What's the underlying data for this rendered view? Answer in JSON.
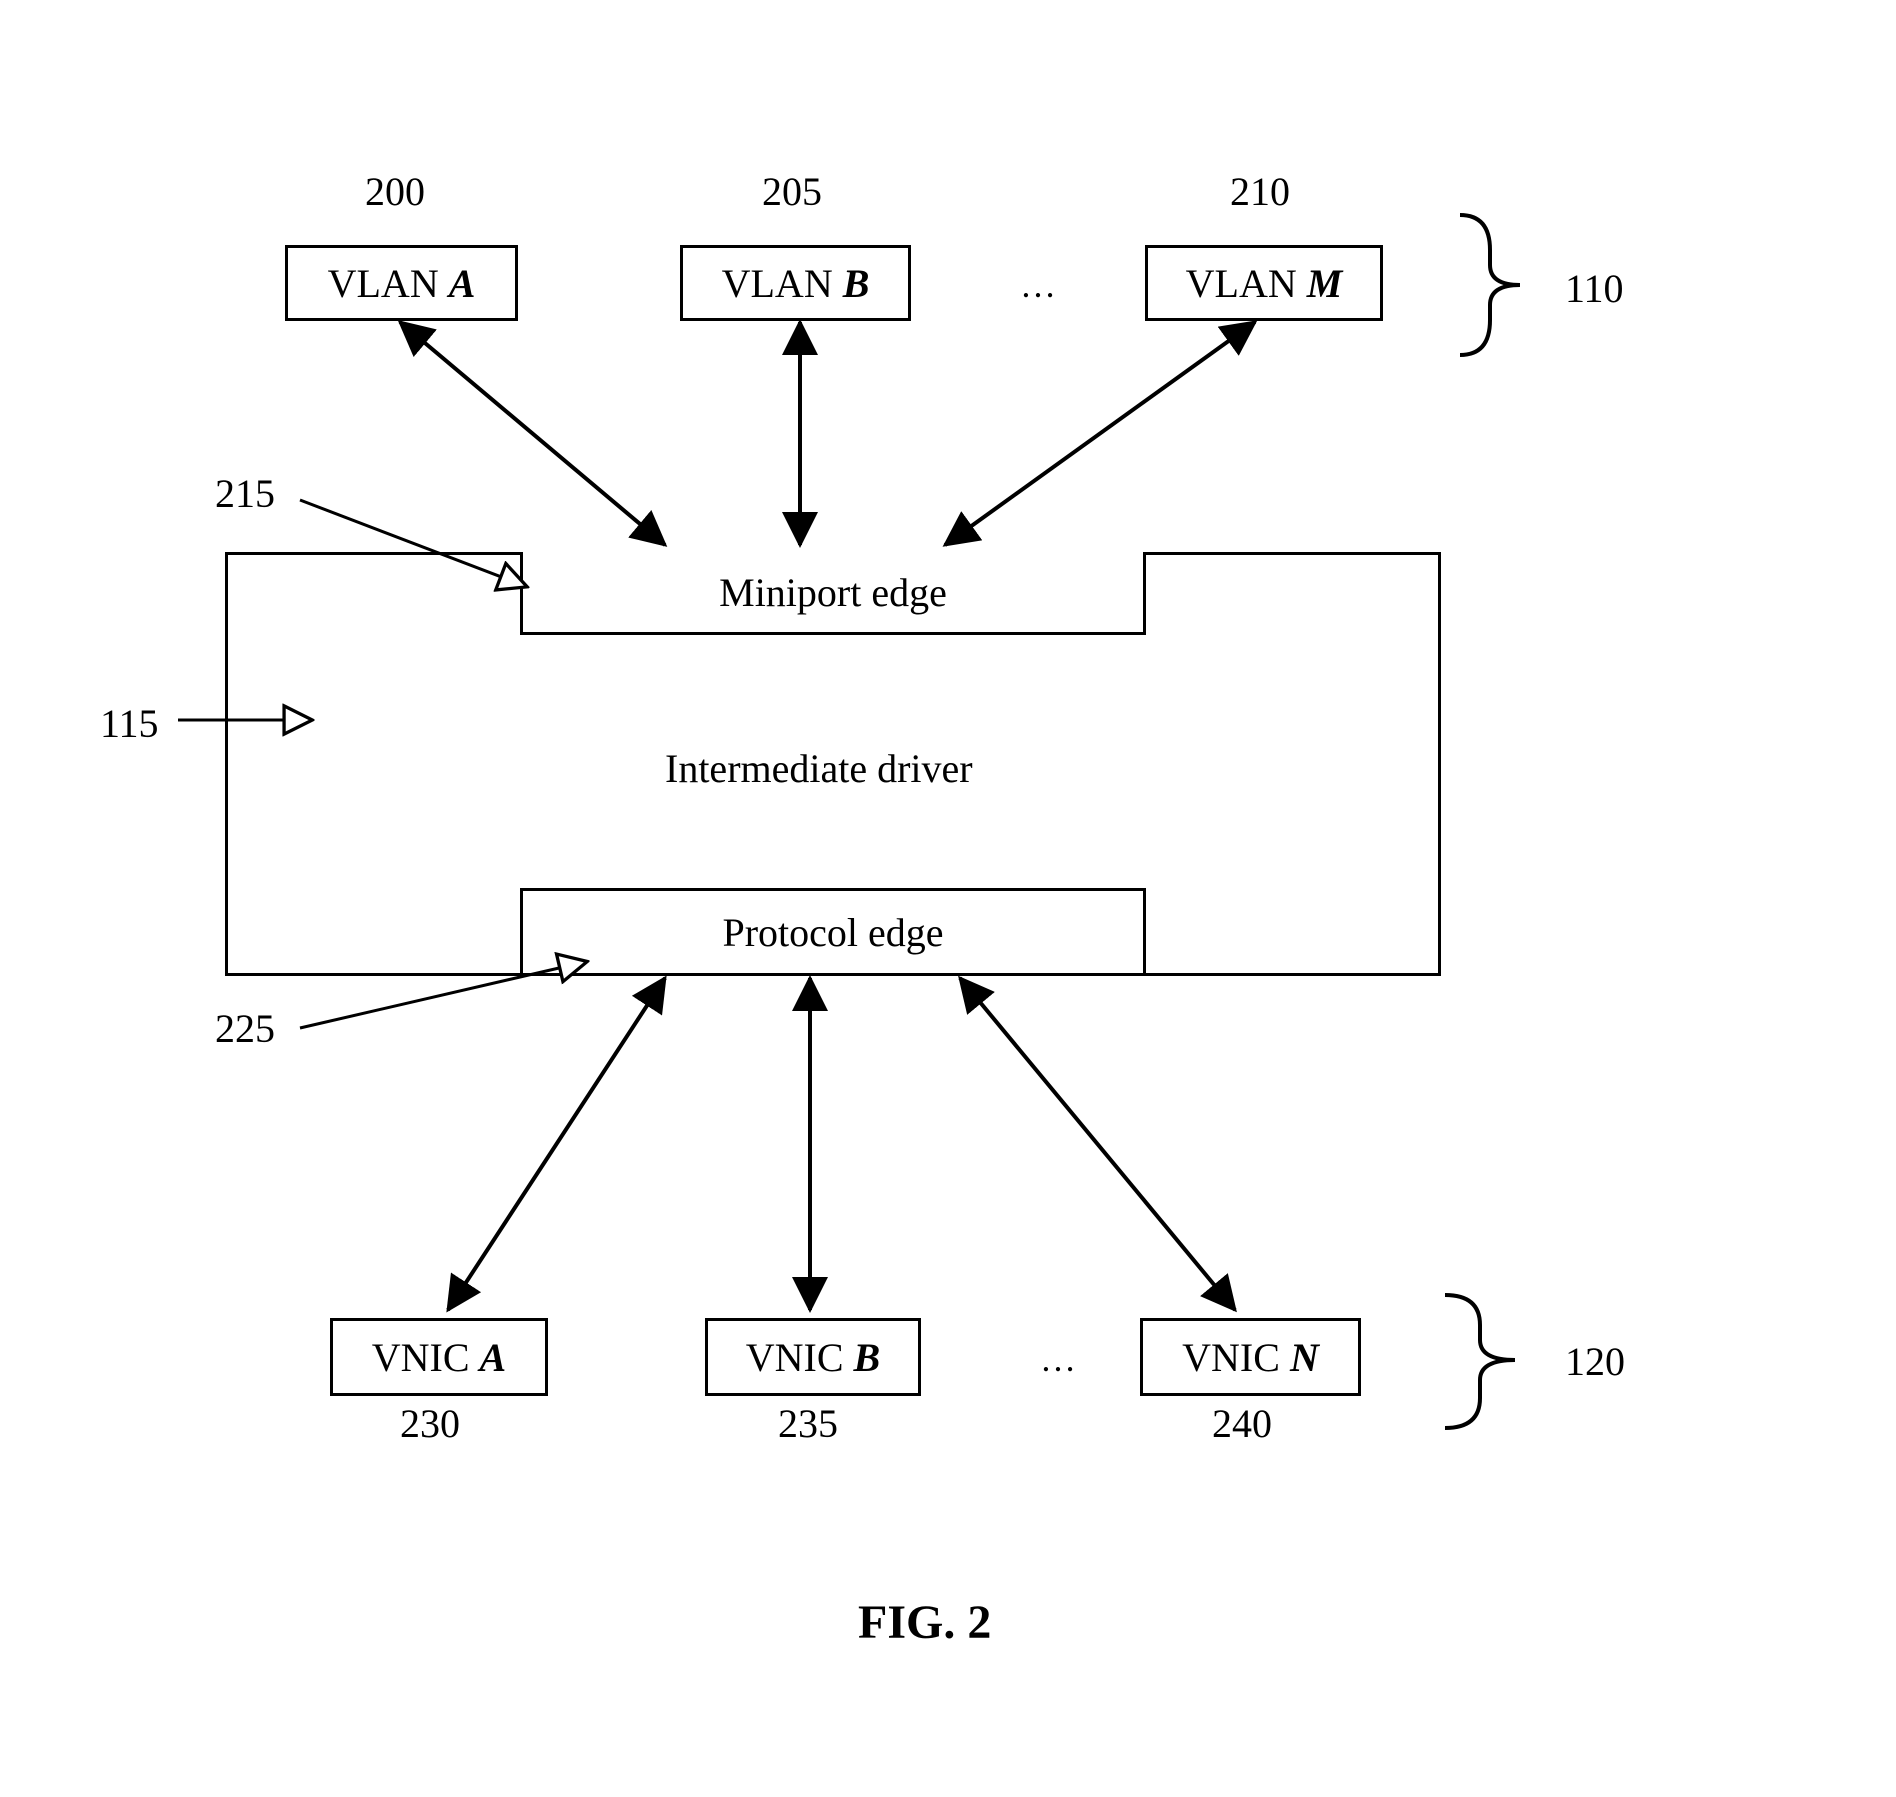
{
  "figure_title": "FIG. 2",
  "top": {
    "group_ref": "110",
    "items": [
      {
        "ref": "200",
        "prefix": "VLAN ",
        "suffix": "A"
      },
      {
        "ref": "205",
        "prefix": "VLAN ",
        "suffix": "B"
      },
      {
        "ref": "210",
        "prefix": "VLAN ",
        "suffix": "M"
      }
    ],
    "ellipsis": "…"
  },
  "driver": {
    "ref": "115",
    "label": "Intermediate driver",
    "miniport": {
      "ref": "215",
      "label": "Miniport edge"
    },
    "protocol": {
      "ref": "225",
      "label": "Protocol edge"
    }
  },
  "bottom": {
    "group_ref": "120",
    "items": [
      {
        "ref": "230",
        "prefix": "VNIC ",
        "suffix": "A"
      },
      {
        "ref": "235",
        "prefix": "VNIC ",
        "suffix": "B"
      },
      {
        "ref": "240",
        "prefix": "VNIC ",
        "suffix": "N"
      }
    ],
    "ellipsis": "…"
  }
}
